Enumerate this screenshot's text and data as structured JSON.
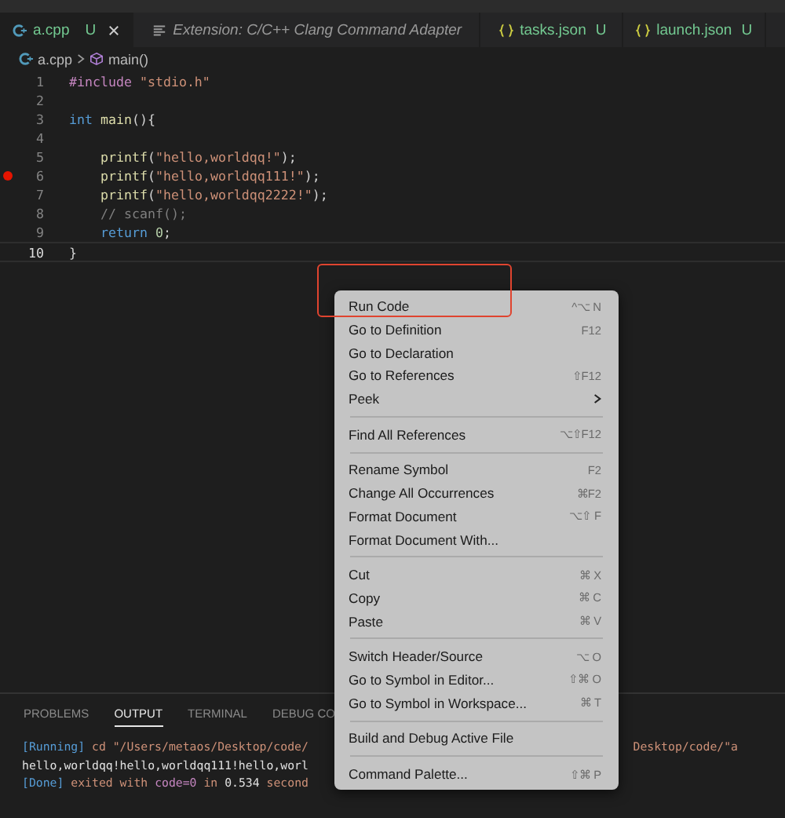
{
  "tabs": [
    {
      "label": "a.cpp",
      "kind": "cpp",
      "badge": "U",
      "closable": true,
      "italic": false,
      "selected": true
    },
    {
      "label": "Extension: C/C++ Clang Command Adapter",
      "kind": "doc",
      "italic": true,
      "selected": false
    },
    {
      "label": "tasks.json",
      "kind": "json",
      "badge": "U",
      "italic": false,
      "selected": false
    },
    {
      "label": "launch.json",
      "kind": "json",
      "badge": "U",
      "italic": false,
      "selected": false
    }
  ],
  "breadcrumb": [
    {
      "label": "a.cpp",
      "kind": "cpp"
    },
    {
      "label": "main()",
      "kind": "symbol"
    }
  ],
  "code": [
    {
      "number": "1",
      "breakpoint": false,
      "current": false,
      "indented": false,
      "tokens": [
        {
          "kind": "pre",
          "text": "#include "
        },
        {
          "kind": "str",
          "text": "\"stdio.h\""
        }
      ]
    },
    {
      "number": "2",
      "breakpoint": false,
      "current": false
    },
    {
      "number": "3",
      "breakpoint": false,
      "current": false,
      "indented": false,
      "tokens": [
        {
          "kind": "kw",
          "text": "int "
        },
        {
          "kind": "fn",
          "text": "main"
        },
        {
          "kind": "plain",
          "text": "(){"
        }
      ]
    },
    {
      "number": "4",
      "breakpoint": false,
      "current": false
    },
    {
      "number": "5",
      "breakpoint": false,
      "current": false,
      "indented": true,
      "tokens": [
        {
          "kind": "fn",
          "text": "printf"
        },
        {
          "kind": "plain",
          "text": "("
        },
        {
          "kind": "str",
          "text": "\"hello,worldqq!\""
        },
        {
          "kind": "plain",
          "text": ");"
        }
      ]
    },
    {
      "number": "6",
      "breakpoint": true,
      "current": false,
      "indented": true,
      "tokens": [
        {
          "kind": "fn",
          "text": "printf"
        },
        {
          "kind": "plain",
          "text": "("
        },
        {
          "kind": "str",
          "text": "\"hello,worldqq111!\""
        },
        {
          "kind": "plain",
          "text": ");"
        }
      ]
    },
    {
      "number": "7",
      "breakpoint": false,
      "current": false,
      "indented": true,
      "tokens": [
        {
          "kind": "fn",
          "text": "printf"
        },
        {
          "kind": "plain",
          "text": "("
        },
        {
          "kind": "str",
          "text": "\"hello,worldqq2222!\""
        },
        {
          "kind": "plain",
          "text": ");"
        }
      ]
    },
    {
      "number": "8",
      "breakpoint": false,
      "current": false,
      "indented": true,
      "tokens": [
        {
          "kind": "comment",
          "text": "// scanf();"
        }
      ]
    },
    {
      "number": "9",
      "breakpoint": false,
      "current": false,
      "indented": true,
      "tokens": [
        {
          "kind": "kw",
          "text": "return "
        },
        {
          "kind": "num",
          "text": "0"
        },
        {
          "kind": "plain",
          "text": ";"
        }
      ]
    },
    {
      "number": "10",
      "breakpoint": false,
      "current": true,
      "indented": false,
      "tokens": [
        {
          "kind": "plain",
          "text": "}"
        }
      ]
    }
  ],
  "panel": {
    "tabs": [
      {
        "label": "PROBLEMS",
        "selected": false
      },
      {
        "label": "OUTPUT",
        "selected": true
      },
      {
        "label": "TERMINAL",
        "selected": false
      },
      {
        "label": "DEBUG CO",
        "selected": false
      }
    ],
    "output": [
      {
        "left": [
          {
            "kind": "tag",
            "text": "[Running]"
          },
          {
            "kind": "path",
            "text": " cd \"/Users/metaos/Desktop/code/"
          }
        ],
        "right": [
          {
            "kind": "path",
            "text": "Desktop/code/\"a"
          }
        ]
      },
      {
        "left": [
          {
            "kind": "plain",
            "text": "hello,worldqq!hello,worldqq111!hello,worl"
          }
        ]
      },
      {
        "left": [
          {
            "kind": "tag",
            "text": "[Done]"
          },
          {
            "kind": "path",
            "text": " exited with "
          },
          {
            "kind": "tag2",
            "text": "code=0"
          },
          {
            "kind": "path",
            "text": " in "
          },
          {
            "kind": "plain",
            "text": "0.534"
          },
          {
            "kind": "path",
            "text": " second"
          }
        ]
      }
    ]
  },
  "context_menu": [
    {
      "kind": "item",
      "label": "Run Code",
      "shortcut": "^⌥ N",
      "annotated": true
    },
    {
      "kind": "item",
      "label": "Go to Definition",
      "shortcut": "F12",
      "annotated": false
    },
    {
      "kind": "item",
      "label": "Go to Declaration",
      "annotated": false
    },
    {
      "kind": "item",
      "label": "Go to References",
      "shortcut": "⇧F12",
      "annotated": false
    },
    {
      "kind": "submenu",
      "label": "Peek",
      "annotated": false
    },
    {
      "kind": "separator"
    },
    {
      "kind": "item",
      "label": "Find All References",
      "shortcut": "⌥⇧F12",
      "annotated": false
    },
    {
      "kind": "separator"
    },
    {
      "kind": "item",
      "label": "Rename Symbol",
      "shortcut": "F2",
      "annotated": false
    },
    {
      "kind": "item",
      "label": "Change All Occurrences",
      "shortcut": "⌘F2",
      "annotated": false
    },
    {
      "kind": "item",
      "label": "Format Document",
      "shortcut": "⌥⇧ F",
      "annotated": false
    },
    {
      "kind": "item",
      "label": "Format Document With...",
      "annotated": false
    },
    {
      "kind": "separator"
    },
    {
      "kind": "item",
      "label": "Cut",
      "shortcut": "⌘ X",
      "annotated": false
    },
    {
      "kind": "item",
      "label": "Copy",
      "shortcut": "⌘ C",
      "annotated": false
    },
    {
      "kind": "item",
      "label": "Paste",
      "shortcut": "⌘ V",
      "annotated": false
    },
    {
      "kind": "separator"
    },
    {
      "kind": "item",
      "label": "Switch Header/Source",
      "shortcut": "⌥ O",
      "annotated": false
    },
    {
      "kind": "item",
      "label": "Go to Symbol in Editor...",
      "shortcut": "⇧⌘ O",
      "annotated": false
    },
    {
      "kind": "item",
      "label": "Go to Symbol in Workspace...",
      "shortcut": "⌘ T",
      "annotated": false
    },
    {
      "kind": "separator"
    },
    {
      "kind": "item",
      "label": "Build and Debug Active File",
      "annotated": false
    },
    {
      "kind": "separator"
    },
    {
      "kind": "item",
      "label": "Command Palette...",
      "shortcut": "⇧⌘ P",
      "annotated": false
    }
  ]
}
